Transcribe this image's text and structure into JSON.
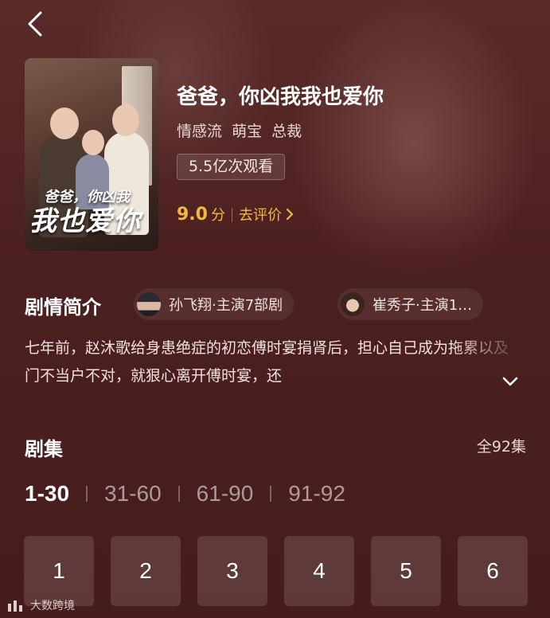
{
  "drama": {
    "title": "爸爸，你凶我我也爱你",
    "tags": [
      "情感流",
      "萌宝",
      "总裁"
    ],
    "views": "5.5亿次观看",
    "score": "9.0",
    "score_unit": "分",
    "rate_label": "去评价",
    "poster_title_line1": "爸爸，你凶我",
    "poster_title_line2": "我也爱你"
  },
  "synopsis": {
    "heading": "剧情简介",
    "text": "七年前，赵沐歌给身患绝症的初恋傅时宴捐肾后，担心自己成为拖累以及门不当户不对，就狠心离开傅时宴，还"
  },
  "actors": [
    {
      "label": "孙飞翔·主演7部剧"
    },
    {
      "label": "崔秀子·主演1…"
    }
  ],
  "episodes": {
    "heading": "剧集",
    "total": "全92集",
    "ranges": [
      "1-30",
      "31-60",
      "61-90",
      "91-92"
    ],
    "active_range": "1-30",
    "items": [
      "1",
      "2",
      "3",
      "4",
      "5",
      "6"
    ]
  },
  "watermark": "大数跨境",
  "colors": {
    "background": "#4a1f1f",
    "accent": "#f5b83a",
    "tile": "rgba(255,255,255,0.13)"
  },
  "icons": [
    "back-chevron-icon",
    "chevron-right-icon",
    "chevron-down-icon",
    "watermark-logo-icon"
  ]
}
